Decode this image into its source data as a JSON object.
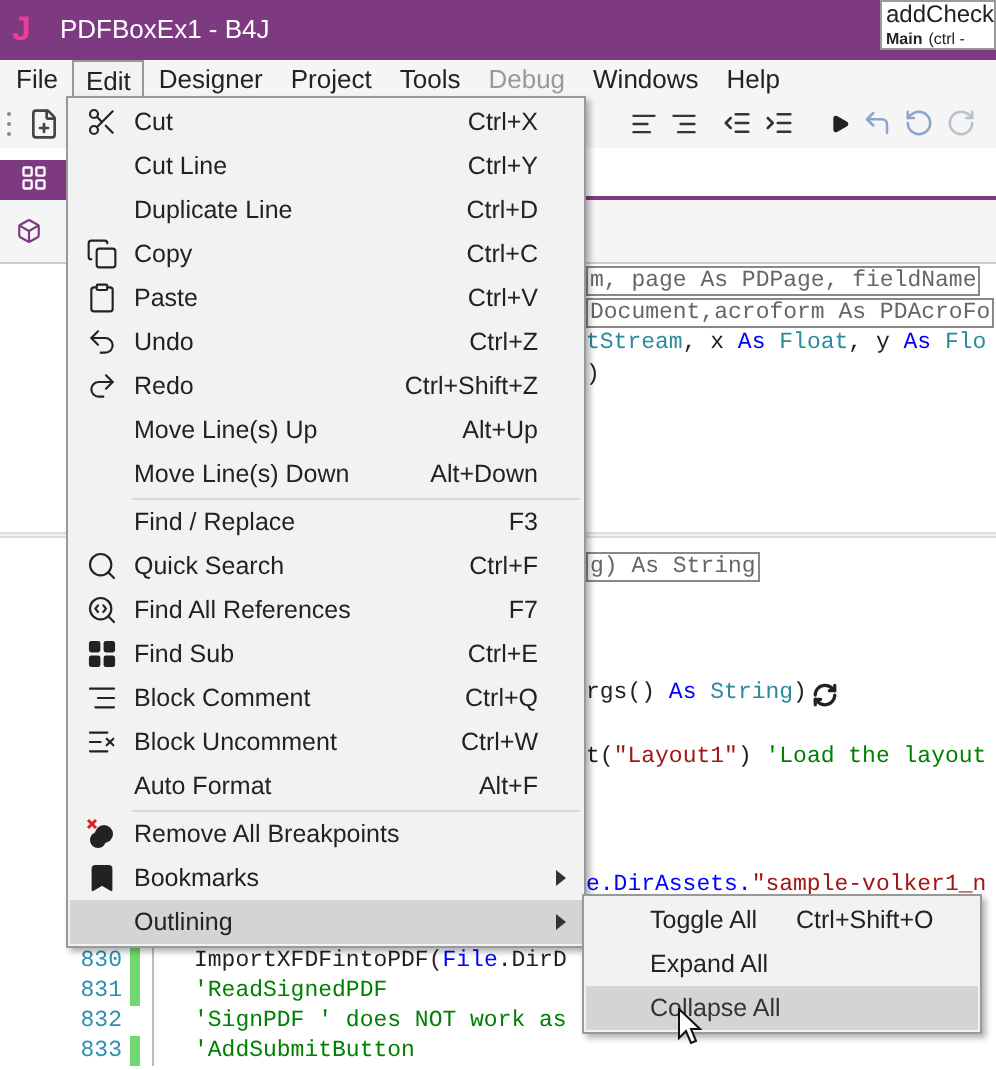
{
  "window": {
    "title": "PDFBoxEx1 - B4J",
    "app_letter": "J"
  },
  "tooltip": {
    "title": "addCheck",
    "module": "Main",
    "hint": "(ctrl -"
  },
  "menu_bar": [
    {
      "label": "File",
      "selected": false,
      "disabled": false
    },
    {
      "label": "Edit",
      "selected": true,
      "disabled": false
    },
    {
      "label": "Designer",
      "selected": false,
      "disabled": false
    },
    {
      "label": "Project",
      "selected": false,
      "disabled": false
    },
    {
      "label": "Tools",
      "selected": false,
      "disabled": false
    },
    {
      "label": "Debug",
      "selected": false,
      "disabled": true
    },
    {
      "label": "Windows",
      "selected": false,
      "disabled": false
    },
    {
      "label": "Help",
      "selected": false,
      "disabled": false
    }
  ],
  "edit_menu": [
    {
      "kind": "item",
      "label": "Cut",
      "shortcut": "Ctrl+X",
      "submenu": false,
      "selected": false
    },
    {
      "kind": "item",
      "label": "Cut Line",
      "shortcut": "Ctrl+Y",
      "submenu": false,
      "selected": false
    },
    {
      "kind": "item",
      "label": "Duplicate Line",
      "shortcut": "Ctrl+D",
      "submenu": false,
      "selected": false
    },
    {
      "kind": "item",
      "label": "Copy",
      "shortcut": "Ctrl+C",
      "submenu": false,
      "selected": false
    },
    {
      "kind": "item",
      "label": "Paste",
      "shortcut": "Ctrl+V",
      "submenu": false,
      "selected": false
    },
    {
      "kind": "item",
      "label": "Undo",
      "shortcut": "Ctrl+Z",
      "submenu": false,
      "selected": false
    },
    {
      "kind": "item",
      "label": "Redo",
      "shortcut": "Ctrl+Shift+Z",
      "submenu": false,
      "selected": false
    },
    {
      "kind": "item",
      "label": "Move Line(s) Up",
      "shortcut": "Alt+Up",
      "submenu": false,
      "selected": false
    },
    {
      "kind": "item",
      "label": "Move Line(s) Down",
      "shortcut": "Alt+Down",
      "submenu": false,
      "selected": false
    },
    {
      "kind": "separator"
    },
    {
      "kind": "item",
      "label": "Find / Replace",
      "shortcut": "F3",
      "submenu": false,
      "selected": false
    },
    {
      "kind": "item",
      "label": "Quick Search",
      "shortcut": "Ctrl+F",
      "submenu": false,
      "selected": false
    },
    {
      "kind": "item",
      "label": "Find All References",
      "shortcut": "F7",
      "submenu": false,
      "selected": false
    },
    {
      "kind": "item",
      "label": "Find Sub",
      "shortcut": "Ctrl+E",
      "submenu": false,
      "selected": false
    },
    {
      "kind": "item",
      "label": "Block Comment",
      "shortcut": "Ctrl+Q",
      "submenu": false,
      "selected": false
    },
    {
      "kind": "item",
      "label": "Block Uncomment",
      "shortcut": "Ctrl+W",
      "submenu": false,
      "selected": false
    },
    {
      "kind": "item",
      "label": "Auto Format",
      "shortcut": "Alt+F",
      "submenu": false,
      "selected": false
    },
    {
      "kind": "separator"
    },
    {
      "kind": "item",
      "label": "Remove All Breakpoints",
      "submenu": false,
      "selected": false
    },
    {
      "kind": "item",
      "label": "Bookmarks",
      "submenu": true,
      "selected": false
    },
    {
      "kind": "item",
      "label": "Outlining",
      "submenu": true,
      "selected": true
    }
  ],
  "outlining_submenu": [
    {
      "label": "Toggle All",
      "shortcut": "Ctrl+Shift+O",
      "selected": false
    },
    {
      "label": "Expand All",
      "selected": false
    },
    {
      "label": "Collapse All",
      "selected": true
    }
  ],
  "code_lines": [
    {
      "kind": "fragment",
      "boxed": true,
      "tokens": [
        {
          "text": "m, page As PDPage, fieldName",
          "kind": "plain"
        }
      ]
    },
    {
      "kind": "fragment",
      "boxed": true,
      "tokens": [
        {
          "text": "Document,acroform As PDAcroFo",
          "kind": "plain"
        }
      ]
    },
    {
      "kind": "fragment",
      "boxed": false,
      "tokens": [
        {
          "text": "tStream",
          "kind": "type"
        },
        {
          "text": ", x ",
          "kind": "plain"
        },
        {
          "text": "As",
          "kind": "keyword"
        },
        {
          "text": " Float",
          "kind": "type"
        },
        {
          "text": ", y ",
          "kind": "plain"
        },
        {
          "text": "As",
          "kind": "keyword"
        },
        {
          "text": " Flo",
          "kind": "type"
        }
      ]
    },
    {
      "kind": "fragment",
      "boxed": false,
      "tokens": [
        {
          "text": ")",
          "kind": "plain"
        }
      ]
    },
    {
      "kind": "blank"
    },
    {
      "kind": "blank"
    },
    {
      "kind": "blank"
    },
    {
      "kind": "blank"
    },
    {
      "kind": "divider"
    },
    {
      "kind": "fragment",
      "boxed": true,
      "tokens": [
        {
          "text": "g) As String",
          "kind": "plain"
        }
      ]
    },
    {
      "kind": "blank"
    },
    {
      "kind": "blank"
    },
    {
      "kind": "blank"
    },
    {
      "kind": "fragment",
      "boxed": false,
      "refresh": true,
      "tokens": [
        {
          "text": "rgs() ",
          "kind": "plain"
        },
        {
          "text": "As",
          "kind": "keyword"
        },
        {
          "text": " String",
          "kind": "type"
        },
        {
          "text": ")",
          "kind": "plain"
        }
      ]
    },
    {
      "kind": "blank"
    },
    {
      "kind": "fragment",
      "boxed": false,
      "tokens": [
        {
          "text": "t(",
          "kind": "plain"
        },
        {
          "text": "\"Layout1\"",
          "kind": "string"
        },
        {
          "text": ") ",
          "kind": "plain"
        },
        {
          "text": "'Load the layout",
          "kind": "comment"
        }
      ]
    },
    {
      "kind": "blank"
    },
    {
      "kind": "blank"
    },
    {
      "kind": "blank"
    },
    {
      "kind": "fragment",
      "boxed": false,
      "tokens": [
        {
          "text": "e.DirAssets.",
          "kind": "keyword"
        },
        {
          "text": "\"sample-volker1_n",
          "kind": "string"
        }
      ]
    },
    {
      "kind": "blank"
    },
    {
      "kind": "numbered",
      "number": "830",
      "changed": true,
      "tokens": [
        {
          "text": "ImportXFDFintoPDF(",
          "kind": "plain"
        },
        {
          "text": "File",
          "kind": "keyword"
        },
        {
          "text": ".DirD",
          "kind": "plain"
        }
      ]
    },
    {
      "kind": "numbered",
      "number": "831",
      "changed": true,
      "tokens": [
        {
          "text": "'ReadSignedPDF",
          "kind": "comment"
        }
      ]
    },
    {
      "kind": "numbered",
      "number": "832",
      "changed": false,
      "tokens": [
        {
          "text": "'SignPDF ' does NOT work as",
          "kind": "comment"
        }
      ]
    },
    {
      "kind": "numbered",
      "number": "833",
      "changed": true,
      "tokens": [
        {
          "text": "'AddSubmitButton",
          "kind": "comment"
        }
      ]
    }
  ]
}
